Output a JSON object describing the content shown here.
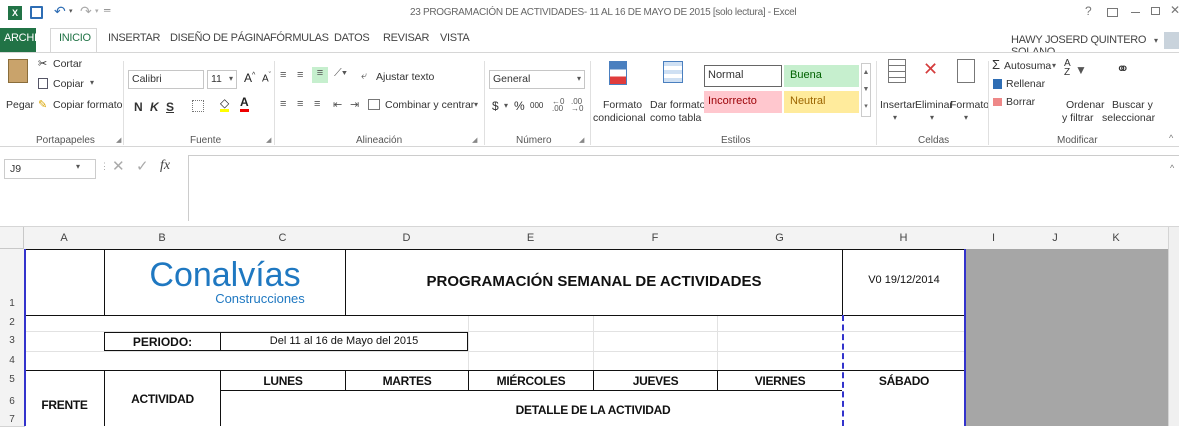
{
  "window": {
    "title": "23 PROGRAMACIÓN DE ACTIVIDADES- 11 AL 16 DE MAYO DE 2015  [solo lectura] - Excel",
    "help": "?",
    "user": "HAWY JOSERD QUINTERO SOLANO"
  },
  "tabs": [
    "ARCHIVO",
    "INICIO",
    "INSERTAR",
    "DISEÑO DE PÁGINA",
    "FÓRMULAS",
    "DATOS",
    "REVISAR",
    "VISTA"
  ],
  "ribbon": {
    "clipboard": {
      "paste": "Pegar",
      "cut": "Cortar",
      "copy": "Copiar",
      "format_painter": "Copiar formato",
      "label": "Portapapeles"
    },
    "font": {
      "name": "Calibri",
      "size": "11",
      "bold": "N",
      "italic": "K",
      "underline": "S",
      "label": "Fuente"
    },
    "alignment": {
      "wrap": "Ajustar texto",
      "merge": "Combinar y centrar",
      "label": "Alineación"
    },
    "number": {
      "format": "General",
      "currency": "$",
      "percent": "%",
      "thousands": "000",
      "label": "Número"
    },
    "styles": {
      "cond_format_1": "Formato",
      "cond_format_2": "condicional",
      "table_format_1": "Dar formato",
      "table_format_2": "como tabla",
      "normal": "Normal",
      "good": "Buena",
      "bad": "Incorrecto",
      "neutral": "Neutral",
      "label": "Estilos"
    },
    "cells": {
      "insert": "Insertar",
      "delete": "Eliminar",
      "format": "Formato",
      "label": "Celdas"
    },
    "editing": {
      "autosum": "Autosuma",
      "fill": "Rellenar",
      "clear": "Borrar",
      "sort_1": "Ordenar",
      "sort_2": "y filtrar",
      "find_1": "Buscar y",
      "find_2": "seleccionar",
      "label": "Modificar"
    }
  },
  "formula_bar": {
    "name_box": "J9",
    "fx": "fx",
    "value": ""
  },
  "columns": [
    "A",
    "B",
    "C",
    "D",
    "E",
    "F",
    "G",
    "H",
    "I",
    "J",
    "K"
  ],
  "rows": [
    "1",
    "2",
    "3",
    "4",
    "5",
    "6",
    "7"
  ],
  "sheet": {
    "logo_main": "Conalvías",
    "logo_sub": "Construcciones",
    "title": "PROGRAMACIÓN SEMANAL DE ACTIVIDADES",
    "version": "V0 19/12/2014",
    "periodo_label": "PERIODO:",
    "periodo_value": "Del 11 al 16 de Mayo del 2015",
    "days": [
      "LUNES",
      "MARTES",
      "MIÉRCOLES",
      "JUEVES",
      "VIERNES",
      "SÁBADO"
    ],
    "frente": "FRENTE",
    "actividad": "ACTIVIDAD",
    "detalle": "DETALLE DE LA ACTIVIDAD"
  },
  "colors": {
    "accent": "#217346",
    "logo": "#1f78c1",
    "normal_style": "#ffffff",
    "good_style": "#c6efce",
    "bad_style": "#ffc7ce",
    "neutral_style": "#ffeb9c",
    "outside_area": "#a6a6a6",
    "frame": "#3333cc"
  }
}
